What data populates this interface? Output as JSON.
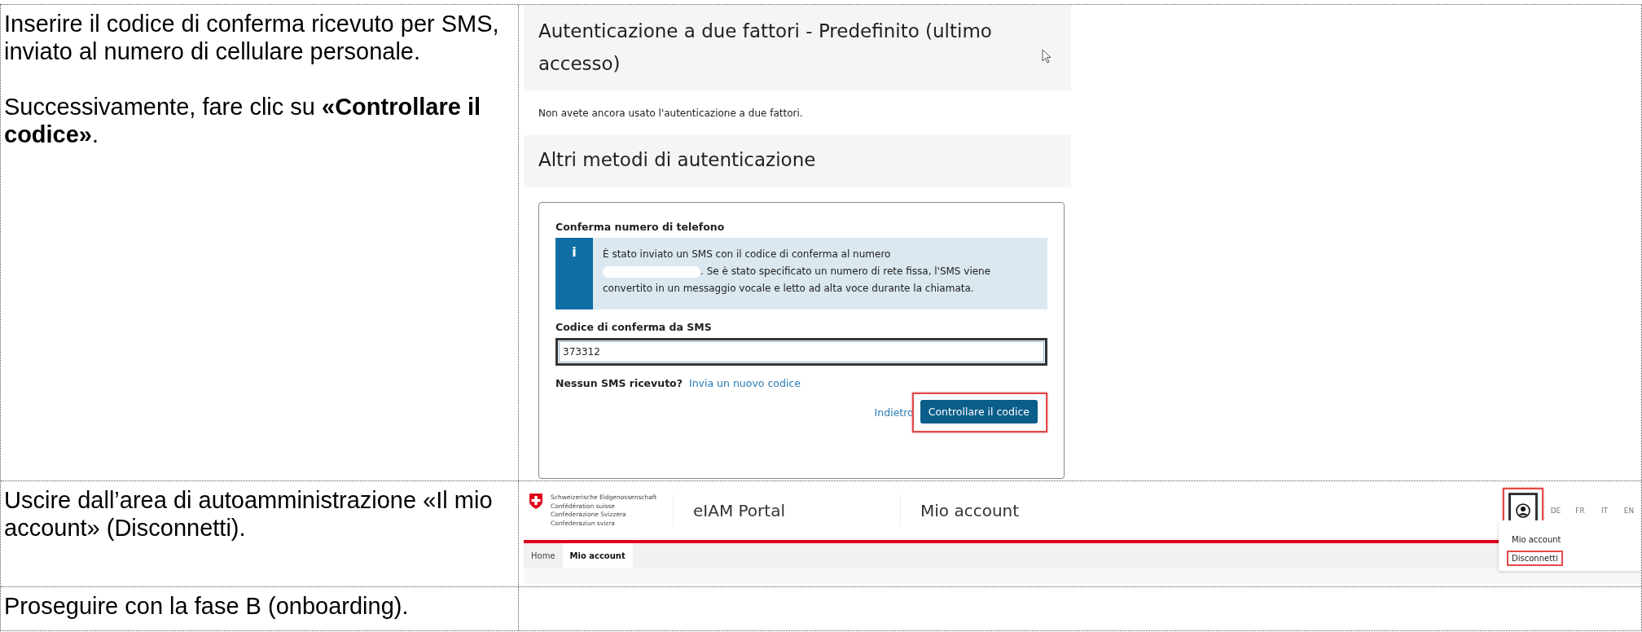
{
  "rows": [
    {
      "instruction": [
        "Inserire il codice di conferma ricevuto per SMS, inviato al numero di cellulare personale.",
        "Successivamente, fare clic su **«Controllare il codice»**."
      ],
      "screenshot": {
        "kind": "two_factor",
        "title": "Autenticazione a due fattori - Predefinito (ultimo accesso)",
        "status_text": "Non avete ancora usato l'autenticazione a due fattori.",
        "section_title": "Altri metodi di autenticazione",
        "card": {
          "title": "Conferma numero di telefono",
          "info_icon": "i",
          "info_text_before": "È stato inviato un SMS con il codice di conferma al numero",
          "info_text_after": [
            ". Se è stato specificato un numero di rete fissa, l'SMS viene",
            "convertito in un messaggio vocale e letto ad alta voce durante la chiamata."
          ],
          "field_label": "Codice di conferma da SMS",
          "field_value": "373312",
          "no_sms_text": "Nessun SMS ricevuto?",
          "resend_link": "Invia un nuovo codice",
          "back_link": "Indietro",
          "submit_button": "Controllare il codice"
        }
      }
    },
    {
      "instruction": [
        "Uscire dall’area di autoamministrazione «Il mio account» (Disconnetti)."
      ],
      "screenshot": {
        "kind": "portal_header",
        "logo_lines": [
          "Schweizerische Eidgenossenschaft",
          "Confédération suisse",
          "Confederazione Svizzera",
          "Confederaziun svizra"
        ],
        "portal_name": "eIAM Portal",
        "page_name": "Mio account",
        "languages": [
          "DE",
          "FR",
          "IT",
          "EN"
        ],
        "tabs": [
          {
            "label": "Home",
            "selected": false
          },
          {
            "label": "Mio account",
            "selected": true
          }
        ],
        "menu": [
          {
            "label": "Mio account",
            "highlighted": false
          },
          {
            "label": "Disconnetti",
            "highlighted": true
          }
        ]
      }
    },
    {
      "instruction": [
        "Proseguire con la fase B (onboarding)."
      ]
    }
  ]
}
